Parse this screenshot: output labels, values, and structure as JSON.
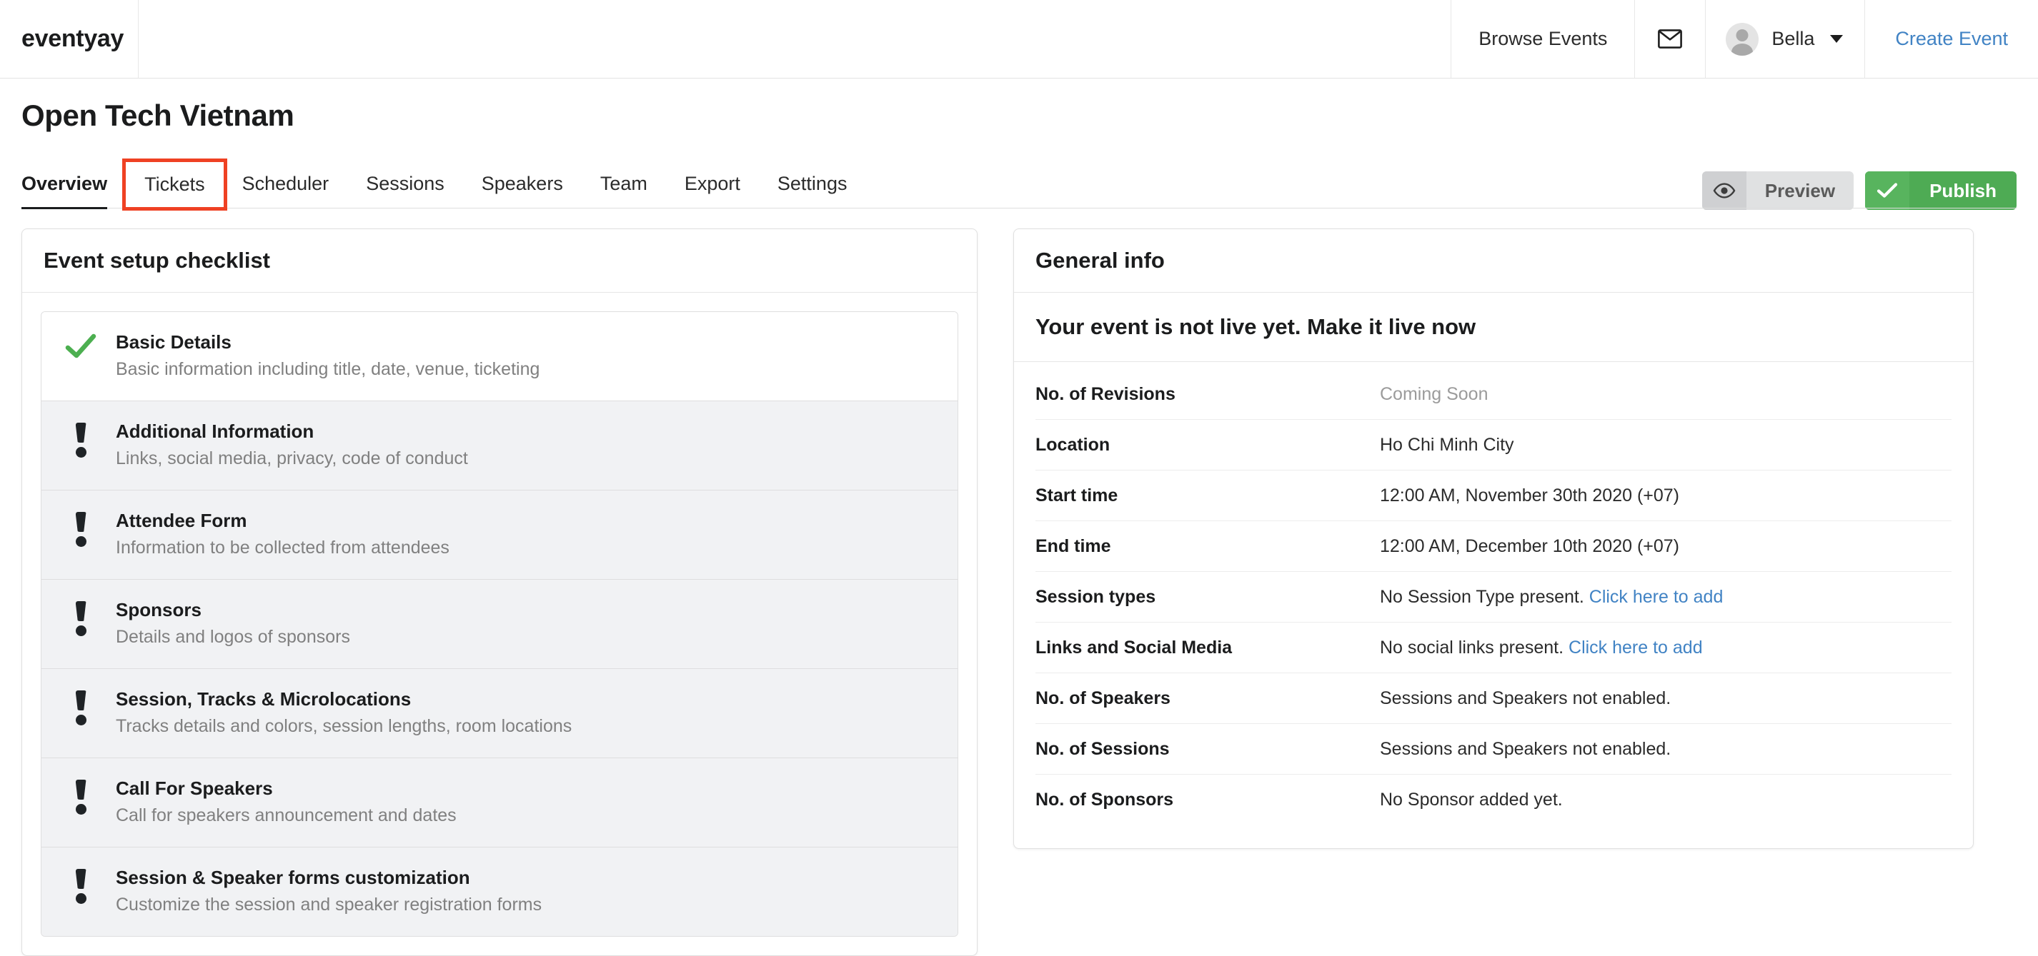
{
  "navbar": {
    "brand": "eventyay",
    "browse_events": "Browse Events",
    "mail_icon": "envelope-icon",
    "user_name": "Bella",
    "create_event": "Create Event"
  },
  "page": {
    "title": "Open Tech Vietnam",
    "preview_label": "Preview",
    "preview_icon": "eye-icon",
    "publish_label": "Publish",
    "publish_icon": "check-icon",
    "highlight_color": "#ef4123"
  },
  "tabs": [
    {
      "label": "Overview",
      "active": true,
      "highlighted": false
    },
    {
      "label": "Tickets",
      "active": false,
      "highlighted": true
    },
    {
      "label": "Scheduler",
      "active": false,
      "highlighted": false
    },
    {
      "label": "Sessions",
      "active": false,
      "highlighted": false
    },
    {
      "label": "Speakers",
      "active": false,
      "highlighted": false
    },
    {
      "label": "Team",
      "active": false,
      "highlighted": false
    },
    {
      "label": "Export",
      "active": false,
      "highlighted": false
    },
    {
      "label": "Settings",
      "active": false,
      "highlighted": false
    }
  ],
  "checklist": {
    "title": "Event setup checklist",
    "items": [
      {
        "name": "Basic Details",
        "desc": "Basic information including title, date, venue, ticketing",
        "status": "done",
        "icon": "check-icon"
      },
      {
        "name": "Additional Information",
        "desc": "Links, social media, privacy, code of conduct",
        "status": "incomplete",
        "icon": "exclamation-icon"
      },
      {
        "name": "Attendee Form",
        "desc": "Information to be collected from attendees",
        "status": "incomplete",
        "icon": "exclamation-icon"
      },
      {
        "name": "Sponsors",
        "desc": "Details and logos of sponsors",
        "status": "incomplete",
        "icon": "exclamation-icon"
      },
      {
        "name": "Session, Tracks & Microlocations",
        "desc": "Tracks details and colors, session lengths, room locations",
        "status": "incomplete",
        "icon": "exclamation-icon"
      },
      {
        "name": "Call For Speakers",
        "desc": "Call for speakers announcement and dates",
        "status": "incomplete",
        "icon": "exclamation-icon"
      },
      {
        "name": "Session & Speaker forms customization",
        "desc": "Customize the session and speaker registration forms",
        "status": "incomplete",
        "icon": "exclamation-icon"
      }
    ]
  },
  "general_info": {
    "title": "General info",
    "banner": "Your event is not live yet. Make it live now",
    "rows": [
      {
        "label": "No. of Revisions",
        "value": "Coming Soon",
        "muted": true,
        "link": ""
      },
      {
        "label": "Location",
        "value": "Ho Chi Minh City",
        "muted": false,
        "link": ""
      },
      {
        "label": "Start time",
        "value": "12:00 AM, November 30th 2020 (+07)",
        "muted": false,
        "link": ""
      },
      {
        "label": "End time",
        "value": "12:00 AM, December 10th 2020 (+07)",
        "muted": false,
        "link": ""
      },
      {
        "label": "Session types",
        "value": "No Session Type present. ",
        "muted": false,
        "link": "Click here to add"
      },
      {
        "label": "Links and Social Media",
        "value": "No social links present. ",
        "muted": false,
        "link": "Click here to add"
      },
      {
        "label": "No. of Speakers",
        "value": "Sessions and Speakers not enabled.",
        "muted": false,
        "link": ""
      },
      {
        "label": "No. of Sessions",
        "value": "Sessions and Speakers not enabled.",
        "muted": false,
        "link": ""
      },
      {
        "label": "No. of Sponsors",
        "value": "No Sponsor added yet.",
        "muted": false,
        "link": ""
      }
    ]
  }
}
